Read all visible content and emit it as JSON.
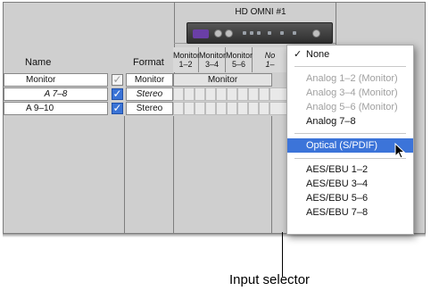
{
  "header": {
    "name_label": "Name",
    "format_label": "Format",
    "device_title": "HD OMNI #1",
    "columns": [
      {
        "line1": "Monitor",
        "line2": "1–2"
      },
      {
        "line1": "Monitor",
        "line2": "3–4"
      },
      {
        "line1": "Monitor",
        "line2": "5–6"
      },
      {
        "line1": "No",
        "line2": "1–"
      }
    ]
  },
  "rows": [
    {
      "name": "Monitor",
      "format": "Monitor",
      "checked": false,
      "assignment": "Monitor"
    },
    {
      "name": "A 7–8",
      "format": "Stereo",
      "checked": true,
      "assignment": ""
    },
    {
      "name": "A 9–10",
      "format": "Stereo",
      "checked": true,
      "assignment": ""
    }
  ],
  "menu": {
    "none_label": "None",
    "check_mark": "✓",
    "analog_items": [
      "Analog 1–2 (Monitor)",
      "Analog 3–4 (Monitor)",
      "Analog 5–6 (Monitor)",
      "Analog 7–8"
    ],
    "optical_label": "Optical (S/PDIF)",
    "aes_items": [
      "AES/EBU 1–2",
      "AES/EBU 3–4",
      "AES/EBU 5–6",
      "AES/EBU 7–8"
    ]
  },
  "callout": {
    "label": "Input selector"
  },
  "colors": {
    "highlight": "#3c74d9",
    "checkbox": "#3a73d6",
    "panel": "#cfcfcf"
  },
  "icons": {
    "check": "checkmark-icon",
    "cursor": "mouse-pointer-icon"
  }
}
